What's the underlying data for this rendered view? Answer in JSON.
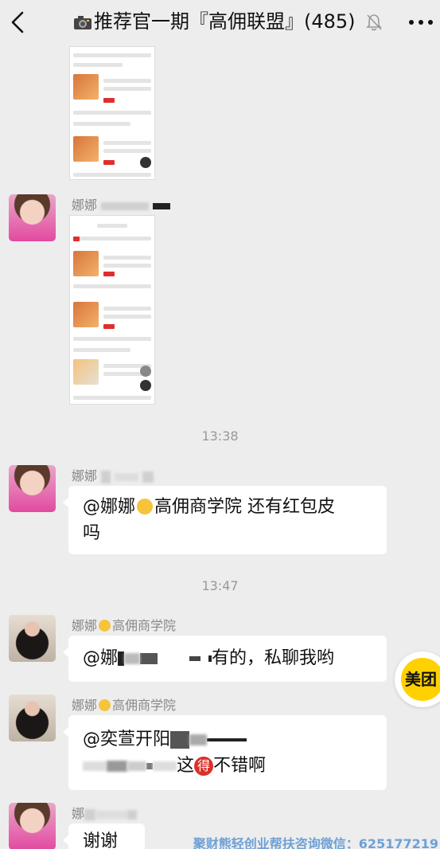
{
  "header": {
    "title_prefix": "推荐官一期『高佣联盟』",
    "member_count": "(485)"
  },
  "chat": {
    "timestamps": [
      "13:38",
      "13:47"
    ],
    "messages": [
      {
        "sender": "娜娜",
        "text": ""
      },
      {
        "sender": "娜娜",
        "text_prefix": "@娜娜",
        "text_suffix": "高佣商学院  还有红包皮",
        "text_line2": "吗"
      },
      {
        "sender": "娜娜",
        "sender_suffix": "高佣商学院",
        "text_prefix": "@娜",
        "text_suffix": "有的，私聊我哟"
      },
      {
        "sender": "娜娜",
        "sender_suffix": "高佣商学院",
        "text_prefix": "@奕萱开阳",
        "text_line2_mid": "这",
        "text_line2_badge": "得",
        "text_line2_end": "不错啊"
      },
      {
        "sender": "娜",
        "text": "谢谢"
      }
    ]
  },
  "floating_badge": {
    "label": "美团"
  },
  "watermark": "聚财熊轻创业帮扶咨询微信：625177219",
  "colors": {
    "background": "#ededed",
    "bubble": "#ffffff",
    "meituan_yellow": "#ffd100",
    "watermark": "#6ea0d6"
  }
}
